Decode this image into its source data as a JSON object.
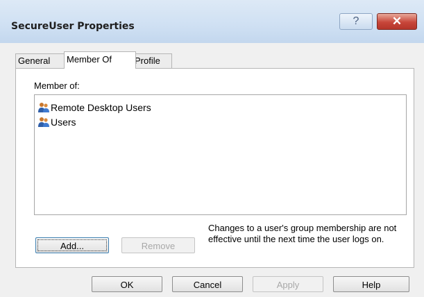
{
  "window": {
    "title": "SecureUser Properties",
    "help_label": "?",
    "close_label": "✕",
    "accent": "#c8463a"
  },
  "tabs": [
    {
      "label": "General"
    },
    {
      "label": "Member Of"
    },
    {
      "label": "Profile"
    }
  ],
  "member_of": {
    "label": "Member of:",
    "groups": [
      {
        "name": "Remote Desktop Users",
        "icon": "group-icon"
      },
      {
        "name": "Users",
        "icon": "group-icon"
      }
    ],
    "add_label": "Add...",
    "remove_label": "Remove",
    "note": "Changes to a user's group membership are not effective until the next time the user logs on."
  },
  "footer": {
    "ok_label": "OK",
    "cancel_label": "Cancel",
    "apply_label": "Apply",
    "help_label": "Help"
  }
}
